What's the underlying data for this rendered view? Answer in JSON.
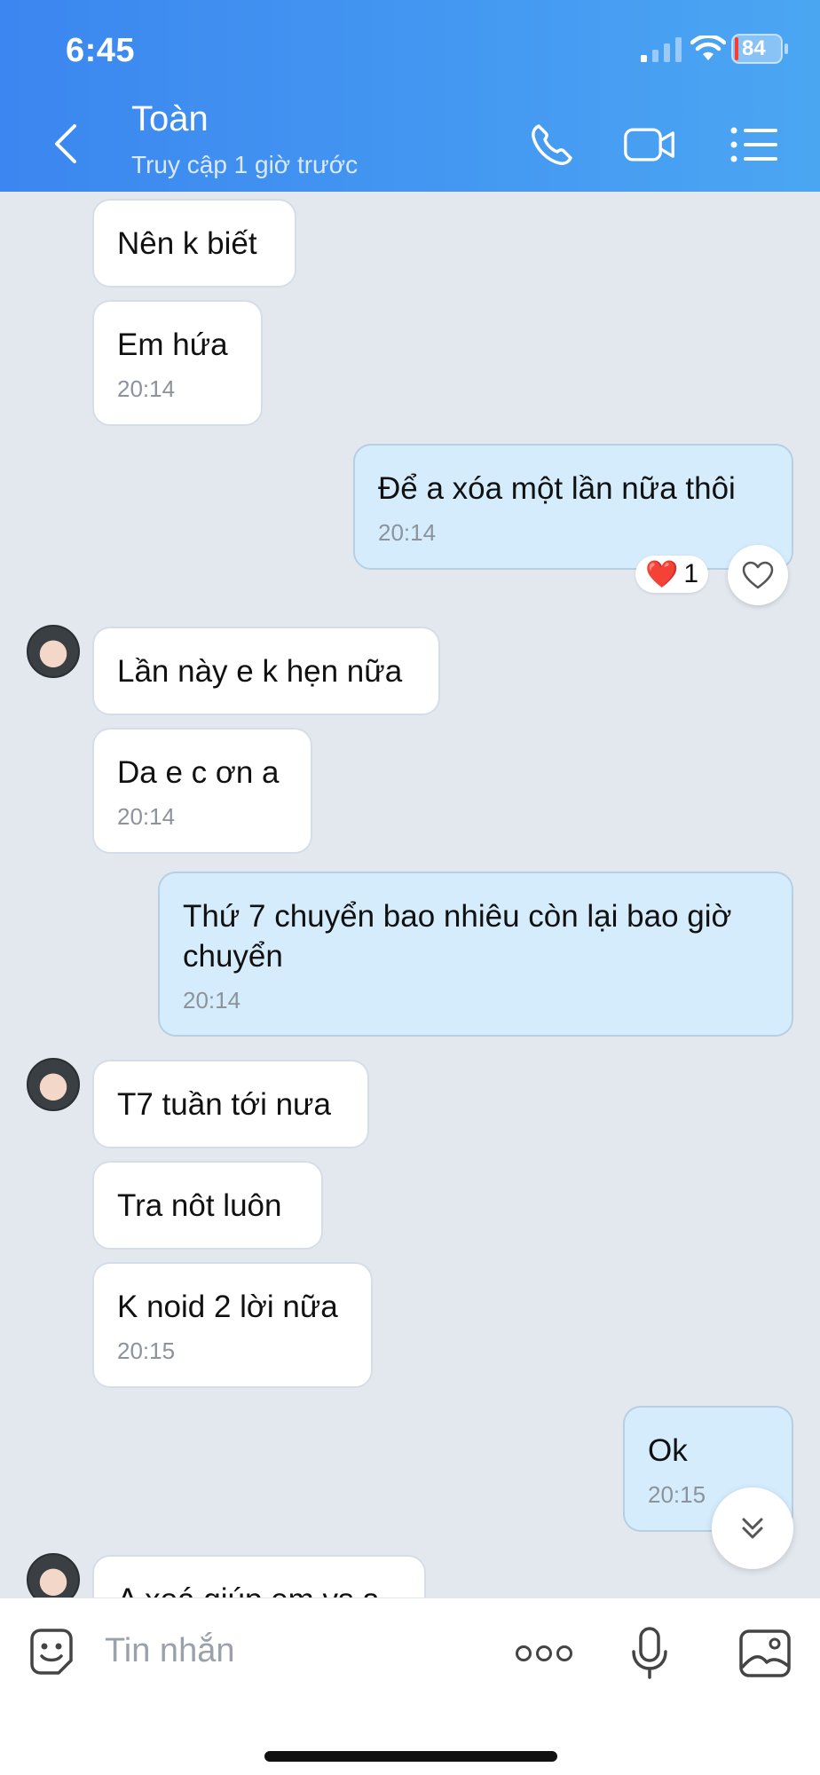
{
  "status_bar": {
    "time": "6:45",
    "battery": "84"
  },
  "header": {
    "name": "Toàn",
    "status": "Truy cập 1 giờ trước",
    "icons": [
      "back-icon",
      "phone-icon",
      "video-call-icon",
      "menu-list-icon"
    ]
  },
  "messages": [
    {
      "dir": "in",
      "text": "Nên k biết"
    },
    {
      "dir": "in",
      "text": "Em hứa",
      "time": "20:14"
    },
    {
      "dir": "out",
      "text": "Để a xóa một lần nữa thôi",
      "time": "20:14"
    },
    {
      "dir": "in",
      "text": "Lần này e k hẹn nữa"
    },
    {
      "dir": "in",
      "text": "Da e c ơn a",
      "time": "20:14"
    },
    {
      "dir": "out",
      "text": "Thứ 7 chuyển bao nhiêu còn lại bao giờ chuyển",
      "time": "20:14"
    },
    {
      "dir": "in",
      "text": "T7 tuần tới nưa"
    },
    {
      "dir": "in",
      "text": "Tra nôt luôn"
    },
    {
      "dir": "in",
      "text": "K noid 2 lời nữa",
      "time": "20:15"
    },
    {
      "dir": "out",
      "text": "Ok",
      "time": "20:15"
    },
    {
      "dir": "in",
      "text": "A xoá giúp em vs a"
    }
  ],
  "reaction": {
    "emoji": "❤️",
    "count": "1"
  },
  "input": {
    "placeholder": "Tin nhắn",
    "icons": [
      "sticker-icon",
      "more-icon",
      "microphone-icon",
      "image-icon"
    ]
  },
  "colors": {
    "header_start": "#3b86f0",
    "header_end": "#4ba6f2",
    "chat_bg": "#e3e8ef",
    "outgoing_bubble": "#d5ecfc",
    "incoming_bubble": "#ffffff"
  }
}
